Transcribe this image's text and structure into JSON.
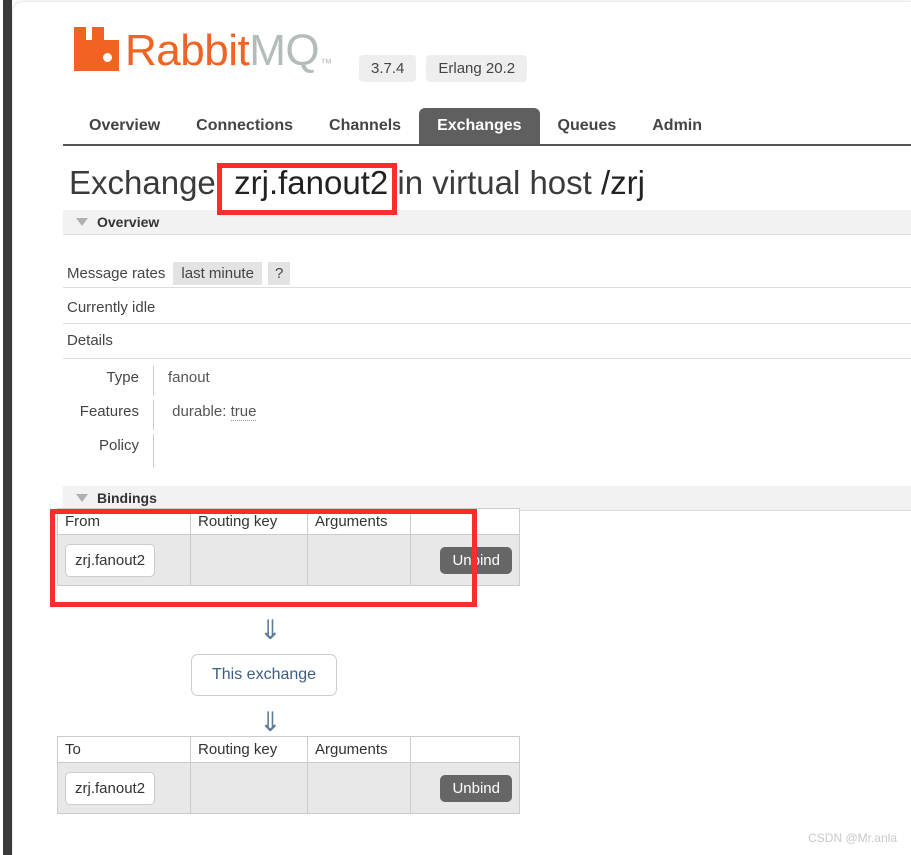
{
  "branding": {
    "logo_icon": "rabbitmq-logo-icon",
    "name_part1": "Rabbit",
    "name_part2": "MQ",
    "trademark": "™",
    "version": "3.7.4",
    "erlang_version": "Erlang 20.2"
  },
  "nav": {
    "items": [
      {
        "label": "Overview",
        "active": false
      },
      {
        "label": "Connections",
        "active": false
      },
      {
        "label": "Channels",
        "active": false
      },
      {
        "label": "Exchanges",
        "active": true
      },
      {
        "label": "Queues",
        "active": false
      },
      {
        "label": "Admin",
        "active": false
      }
    ]
  },
  "page": {
    "title_prefix": "Exchange:",
    "exchange_name": "zrj.fanout2",
    "title_middle": "in virtual host",
    "vhost": "/zrj"
  },
  "overview": {
    "section_label": "Overview",
    "message_rates_label": "Message rates",
    "rate_tab": "last minute",
    "help_tab": "?",
    "idle_text": "Currently idle",
    "details_label": "Details",
    "details": [
      {
        "key": "Type",
        "value": "fanout"
      },
      {
        "key": "Features",
        "value": "durable: true",
        "feature_name": "durable:",
        "feature_value": "true"
      },
      {
        "key": "Policy",
        "value": ""
      }
    ]
  },
  "bindings": {
    "section_label": "Bindings",
    "incoming": {
      "headers": [
        "From",
        "Routing key",
        "Arguments",
        ""
      ],
      "rows": [
        {
          "source": "zrj.fanout2",
          "routing_key": "",
          "arguments": "",
          "action": "Unbind"
        }
      ]
    },
    "exchange_node_label": "This exchange",
    "arrow_glyph": "⇓",
    "outgoing": {
      "headers": [
        "To",
        "Routing key",
        "Arguments",
        ""
      ],
      "rows": [
        {
          "destination": "zrj.fanout2",
          "routing_key": "",
          "arguments": "",
          "action": "Unbind"
        }
      ]
    }
  },
  "watermark": "CSDN @Mr.anla",
  "colors": {
    "brand_orange": "#f26322",
    "brand_gray": "#b4bcb9",
    "active_tab": "#605f5f",
    "annotation_red": "#fa2c2c",
    "button_gray": "#666666"
  }
}
